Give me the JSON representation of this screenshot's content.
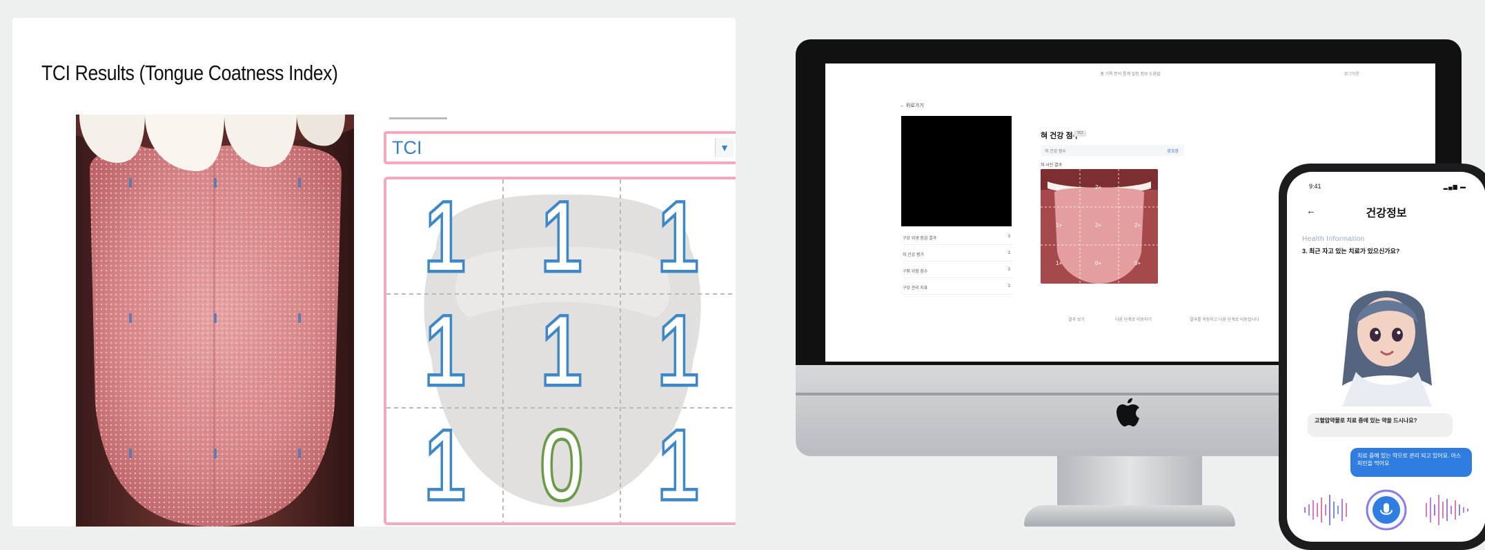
{
  "left_panel": {
    "title": "TCI Results (Tongue Coatness Index)",
    "select": {
      "value": "TCI"
    },
    "grid": {
      "rows": [
        [
          "1",
          "1",
          "1"
        ],
        [
          "1",
          "1",
          "1"
        ],
        [
          "1",
          "0",
          "1"
        ]
      ],
      "colors": {
        "one": "#3e88c8",
        "zero": "#6a9a4a",
        "border": "#f3a8bd"
      }
    }
  },
  "right_panel": {
    "monitor": {
      "nav_items": "홈   기록   분석   통계   설정   정보   도움말",
      "nav_right": "로그아웃",
      "back_label": "← 뒤로가기",
      "side_rows": [
        {
          "label": "구강 위생 점검 결과",
          "value": "3"
        },
        {
          "label": "혀 건강 평가",
          "value": "3"
        },
        {
          "label": "구취 위험 점수",
          "value": "3"
        },
        {
          "label": "구강 관리 지표",
          "value": "3"
        }
      ],
      "score_title": "혀 건강 점수",
      "score_badge": "TCI",
      "input_label": "혀 건강 점수",
      "input_value": "양호함",
      "photo_label": "혀 사진 결과",
      "mouth_scores": [
        "1+",
        "2+",
        "1+",
        "1+",
        "2+",
        "2+",
        "1+",
        "0+",
        "0+"
      ],
      "bottom_labels": [
        "결과 보기",
        "다음 단계로 이동하기",
        "결과를 저장하고 다음 단계로 이동합니다"
      ]
    },
    "phone": {
      "time": "9:41",
      "title": "건강정보",
      "subtitle": "Health Information",
      "question": "3. 최근 자고 있는 치료가 있으신가요?",
      "bubble_left": "고혈압약물로 치료 중에 있는 약을 드시나요?",
      "bubble_right": "치료 중에 있는 약으로 관리 되고 있어요. 아스피린을 먹어요"
    }
  }
}
